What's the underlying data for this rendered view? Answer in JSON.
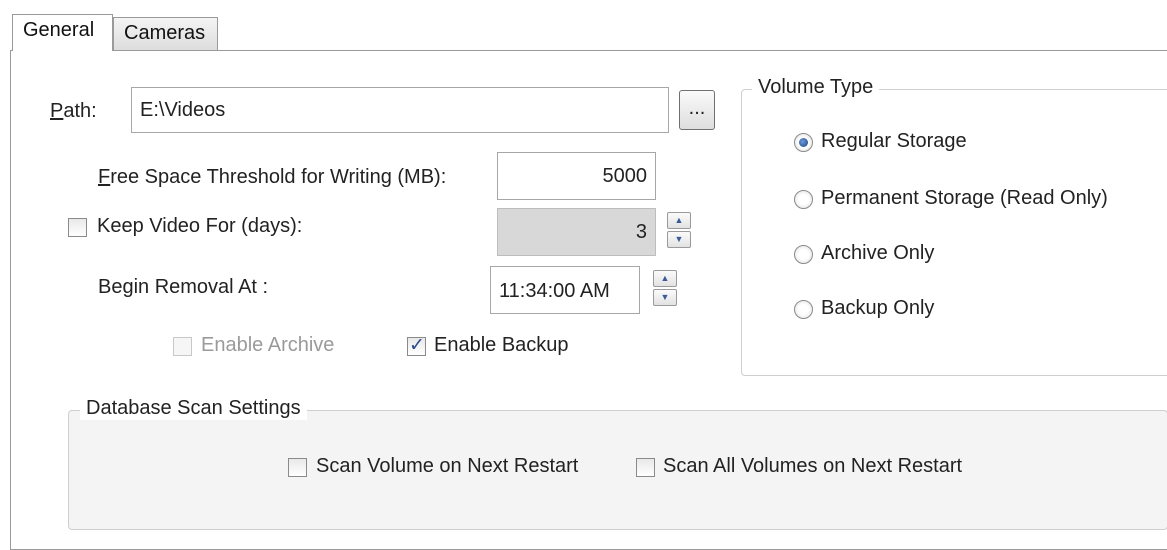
{
  "tabs": [
    {
      "label": "General",
      "active": true
    },
    {
      "label": "Cameras",
      "active": false
    }
  ],
  "path": {
    "label": "Path:",
    "value": "E:\\Videos",
    "browse_label": "..."
  },
  "free_space": {
    "label": "Free Space Threshold for Writing (MB):",
    "value": "5000"
  },
  "keep_video": {
    "label": "Keep Video For (days):",
    "checked": false,
    "value": "3"
  },
  "begin_removal": {
    "label": "Begin Removal At :",
    "value": "11:34:00 AM"
  },
  "enable_archive": {
    "label": "Enable Archive",
    "checked": false,
    "disabled": true
  },
  "enable_backup": {
    "label": "Enable Backup",
    "checked": true
  },
  "volume_type": {
    "title": "Volume Type",
    "options": [
      {
        "label": "Regular Storage",
        "selected": true
      },
      {
        "label": "Permanent Storage (Read Only)",
        "selected": false
      },
      {
        "label": "Archive Only",
        "selected": false
      },
      {
        "label": "Backup Only",
        "selected": false
      }
    ]
  },
  "db_scan": {
    "title": "Database Scan Settings",
    "scan_volume_label": "Scan Volume on Next Restart",
    "scan_all_label": "Scan All Volumes on Next Restart"
  }
}
